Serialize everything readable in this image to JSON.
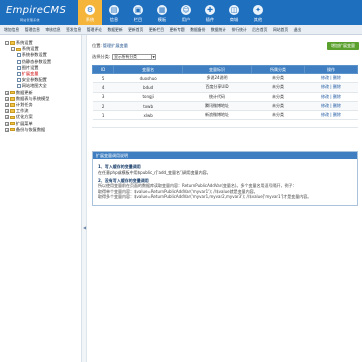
{
  "header": {
    "logo": "EmpireCMS",
    "logo_sub": "网站管理系统",
    "nav": [
      {
        "label": "系统",
        "icon": "gear-icon",
        "glyph": "⚙"
      },
      {
        "label": "信息",
        "icon": "document-icon",
        "glyph": "▤"
      },
      {
        "label": "栏目",
        "icon": "folder-icon",
        "glyph": "▣"
      },
      {
        "label": "模板",
        "icon": "template-icon",
        "glyph": "▦"
      },
      {
        "label": "用户",
        "icon": "user-icon",
        "glyph": "☺"
      },
      {
        "label": "插件",
        "icon": "plugin-icon",
        "glyph": "✚"
      },
      {
        "label": "商城",
        "icon": "cart-icon",
        "glyph": "◫"
      },
      {
        "label": "其他",
        "icon": "more-icon",
        "glyph": "✦"
      }
    ],
    "active_nav": 0
  },
  "subnav": [
    "增加信息",
    "管理信息",
    "审核信息",
    "签发信息",
    "管理评论",
    "数据更新",
    "更新首页",
    "更新栏目",
    "更新专题",
    "数据备份",
    "数据统计",
    "排行统计",
    "后台首页",
    "网站首页",
    "退出"
  ],
  "sidebar": {
    "tree": [
      {
        "level": 0,
        "type": "folder",
        "toggle": "-",
        "label": "系统设置"
      },
      {
        "level": 1,
        "type": "folder",
        "toggle": "-",
        "label": "系统设置"
      },
      {
        "level": 2,
        "type": "file",
        "label": "系统参数设置"
      },
      {
        "level": 2,
        "type": "file",
        "label": "伪静态参数设置"
      },
      {
        "level": 2,
        "type": "file",
        "label": "图片设置"
      },
      {
        "level": 2,
        "type": "file",
        "label": "扩展变量",
        "selected": true
      },
      {
        "level": 2,
        "type": "file",
        "label": "安全参数配置"
      },
      {
        "level": 2,
        "type": "file",
        "label": "网站地图大全"
      },
      {
        "level": 0,
        "type": "folder",
        "toggle": "+",
        "label": "数据更新"
      },
      {
        "level": 0,
        "type": "folder",
        "toggle": "+",
        "label": "数据表与系统模型"
      },
      {
        "level": 0,
        "type": "folder",
        "toggle": "+",
        "label": "计划任务"
      },
      {
        "level": 0,
        "type": "folder",
        "toggle": "+",
        "label": "工作流"
      },
      {
        "level": 0,
        "type": "folder",
        "toggle": "+",
        "label": "优化方案"
      },
      {
        "level": 0,
        "type": "folder",
        "toggle": "+",
        "label": "扩展菜单"
      },
      {
        "level": 0,
        "type": "folder",
        "toggle": "+",
        "label": "备份与恢复数据"
      }
    ]
  },
  "main": {
    "crumb_label": "位置:",
    "crumb_value": "管理扩展变量",
    "add_button": "增加扩展变量",
    "filter_label": "选择分类:",
    "filter_value": "显示所有分类",
    "table": {
      "headers": [
        "ID",
        "变量名",
        "变量标识",
        "所属分类",
        "操作"
      ],
      "rows": [
        [
          "5",
          "duoshuo",
          "多说24说明",
          "未分类",
          "修改 | 删除"
        ],
        [
          "4",
          "bdud",
          "百度分享UID",
          "未分类",
          "修改 | 删除"
        ],
        [
          "3",
          "tongji",
          "统计代码",
          "未分类",
          "修改 | 删除"
        ],
        [
          "2",
          "txwb",
          "腾讯微博地址",
          "未分类",
          "修改 | 删除"
        ],
        [
          "1",
          "xlwb",
          "新浪微博地址",
          "未分类",
          "修改 | 删除"
        ]
      ]
    },
    "help": {
      "title": "扩展变量调用说明",
      "s1_title": "1、写入缓存的变量调用",
      "s1_body": "在任意php或模板中用$public_r['add_变量名']调用变量内容。",
      "s2_title": "2、没有写入缓存的变量调用",
      "s2_body": "所以使用变量前在页面的数据库读取变量内容：ReturnPublicAddVar(变量名)。多个变量名用逗号隔开，例子：",
      "s2_ex1": "取得单个变量内容：$value=ReturnPublicAddVar('myvar1'); //$value就是变量内容。",
      "s2_ex2": "取得多个变量内容：$value=ReturnPublicAddVar('myvar1,myvar2,myvar3'); //$value['myvar1']才是变量内容。"
    }
  }
}
